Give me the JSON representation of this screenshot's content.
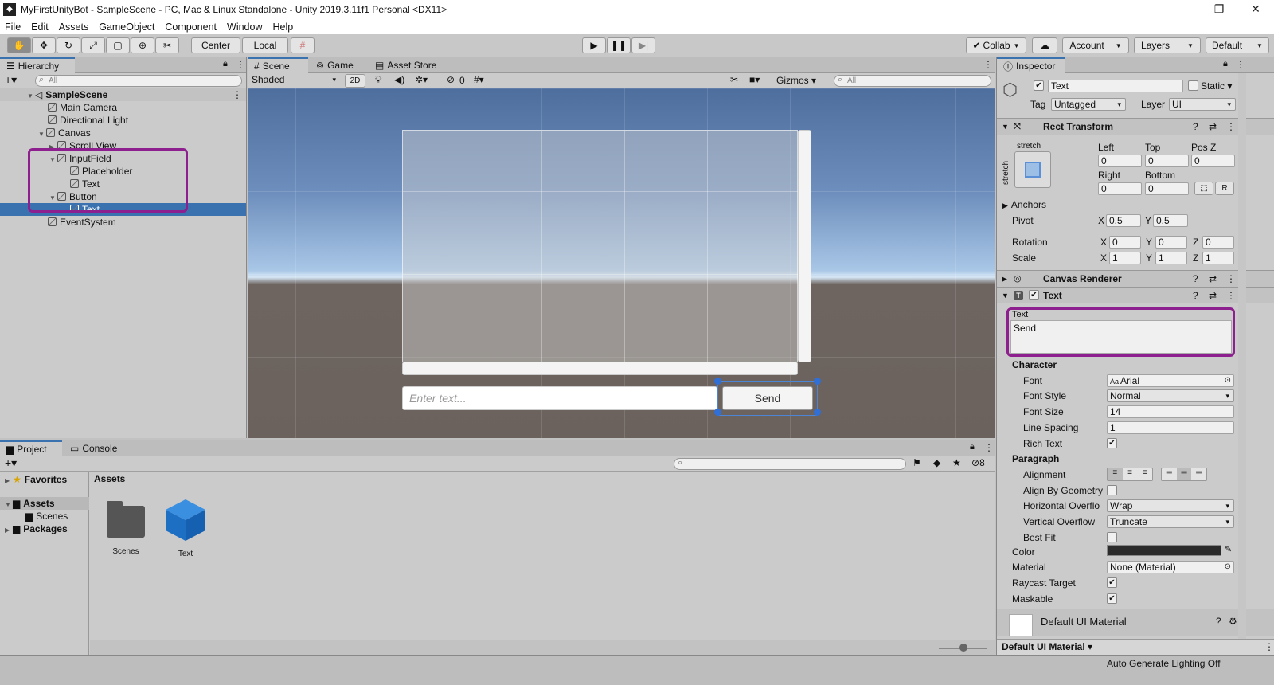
{
  "window": {
    "title": "MyFirstUnityBot - SampleScene - PC, Mac & Linux Standalone - Unity 2019.3.11f1 Personal <DX11>",
    "minimize": "—",
    "maximize": "❐",
    "close": "✕"
  },
  "menu": [
    "File",
    "Edit",
    "Assets",
    "GameObject",
    "Component",
    "Window",
    "Help"
  ],
  "toolbar": {
    "pivot_center": "Center",
    "pivot_local": "Local",
    "collab": "Collab",
    "account": "Account",
    "layers": "Layers",
    "layout": "Default"
  },
  "hierarchy": {
    "tab": "Hierarchy",
    "search_placeholder": "All",
    "scene_name": "SampleScene",
    "items": [
      "Main Camera",
      "Directional Light",
      "Canvas",
      "Scroll View",
      "InputField",
      "Placeholder",
      "Text",
      "Button",
      "Text",
      "EventSystem"
    ]
  },
  "scene": {
    "tabs": [
      "Scene",
      "Game",
      "Asset Store"
    ],
    "shading": "Shaded",
    "mode_2d": "2D",
    "hidden_count": "0",
    "gizmos": "Gizmos",
    "search_placeholder": "All",
    "input_placeholder": "Enter text...",
    "send_label": "Send"
  },
  "project": {
    "tabs": [
      "Project",
      "Console"
    ],
    "favorites": "Favorites",
    "assets": "Assets",
    "scenes": "Scenes",
    "packages": "Packages",
    "breadcrumb": "Assets",
    "hidden_count": "8",
    "grid_items": [
      "Scenes",
      "Text"
    ]
  },
  "inspector": {
    "tab": "Inspector",
    "object_name": "Text",
    "static_label": "Static",
    "tag_label": "Tag",
    "tag_value": "Untagged",
    "layer_label": "Layer",
    "layer_value": "UI",
    "rect_transform": {
      "header": "Rect Transform",
      "stretch_top": "stretch",
      "stretch_side": "stretch",
      "left_label": "Left",
      "left": "0",
      "top_label": "Top",
      "top": "0",
      "posz_label": "Pos Z",
      "posz": "0",
      "right_label": "Right",
      "right": "0",
      "bottom_label": "Bottom",
      "bottom": "0",
      "r_button": "R",
      "anchors": "Anchors",
      "pivot": "Pivot",
      "pivot_x": "0.5",
      "pivot_y": "0.5",
      "rotation": "Rotation",
      "rot_x": "0",
      "rot_y": "0",
      "rot_z": "0",
      "scale": "Scale",
      "scale_x": "1",
      "scale_y": "1",
      "scale_z": "1",
      "x": "X",
      "y": "Y",
      "z": "Z"
    },
    "canvas_renderer": "Canvas Renderer",
    "text_component": {
      "header": "Text",
      "text_label": "Text",
      "text_value": "Send",
      "character": "Character",
      "font_label": "Font",
      "font_value": "Arial",
      "font_style_label": "Font Style",
      "font_style_value": "Normal",
      "font_size_label": "Font Size",
      "font_size_value": "14",
      "line_spacing_label": "Line Spacing",
      "line_spacing_value": "1",
      "rich_text_label": "Rich Text",
      "paragraph": "Paragraph",
      "alignment_label": "Alignment",
      "align_geom_label": "Align By Geometry",
      "horiz_label": "Horizontal Overflo",
      "horiz_value": "Wrap",
      "vert_label": "Vertical Overflow",
      "vert_value": "Truncate",
      "best_fit_label": "Best Fit",
      "color_label": "Color",
      "color_value": "#2b2b2b",
      "material_label": "Material",
      "material_value": "None (Material)",
      "raycast_label": "Raycast Target",
      "maskable_label": "Maskable"
    },
    "material_header": "Default UI Material",
    "material_footer": "Default UI Material"
  },
  "status": {
    "lighting": "Auto Generate Lighting Off"
  },
  "colors": {
    "selection": "#3a72b0",
    "highlight": "#8e1f8e"
  }
}
